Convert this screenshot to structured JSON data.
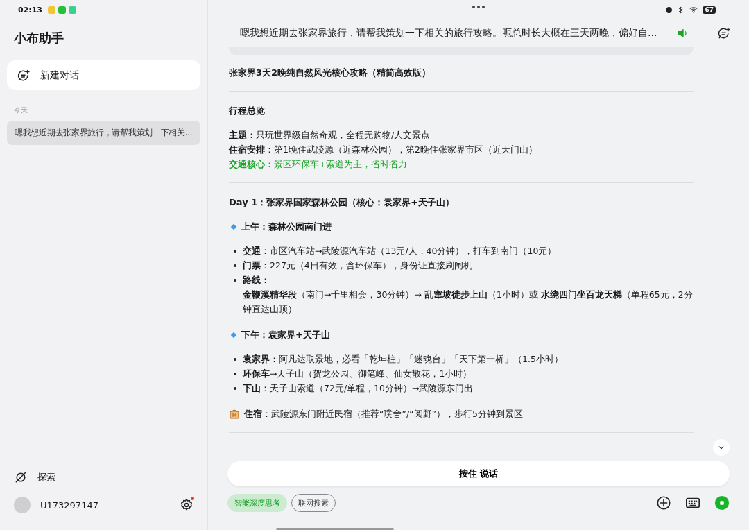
{
  "status_bar": {
    "time": "02:13",
    "battery": "67"
  },
  "sidebar": {
    "title": "小布助手",
    "new_chat": "新建对话",
    "section_label": "今天",
    "history": [
      {
        "text": "嗯我想近期去张家界旅行，请帮我策划一下相关...",
        "selected": true
      }
    ],
    "explore": "探索",
    "user": "U173297147",
    "settings_badge": true
  },
  "header": {
    "query": "嗯我想近期去张家界旅行，请帮我策划一下相关的旅行攻略。呃总时长大概在三天两晚，偏好自..."
  },
  "doc": [
    {
      "kind": "title",
      "text": "张家界3天2晚纯自然风光核心攻略（精简高效版）"
    },
    {
      "kind": "divider"
    },
    {
      "kind": "heading",
      "text": "行程总览"
    },
    {
      "kind": "lines",
      "items": [
        {
          "text": "**主题**：只玩世界级自然奇观，全程无购物/人文景点",
          "highlighted": false
        },
        {
          "text": "**住宿安排**：第1晚住武陵源（近森林公园），第2晚住张家界市区（近天门山）",
          "highlighted": false
        },
        {
          "text": "**交通核心**：景区环保车+索道为主，省时省力",
          "highlighted": true
        }
      ]
    },
    {
      "kind": "divider"
    },
    {
      "kind": "heading",
      "text": "Day 1：张家界国家森林公园（核心：袁家界+天子山）"
    },
    {
      "kind": "section",
      "text": "上午：森林公园南门进"
    },
    {
      "kind": "bullets",
      "items": [
        {
          "text": "**交通**：市区汽车站→武陵源汽车站（13元/人，40分钟），打车到南门（10元）"
        },
        {
          "text": "**门票**：227元（4日有效，含环保车），身份证直接刷闸机"
        },
        {
          "text": "**路线**：",
          "detail": "**金鞭溪精华段**（南门→千里相会，30分钟）→ **乱窜坡徒步上山**（1小时）或 **水绕四门坐百龙天梯**（单程65元，2分钟直达山顶）"
        }
      ]
    },
    {
      "kind": "section",
      "text": "下午：袁家界+天子山"
    },
    {
      "kind": "bullets",
      "items": [
        {
          "text": "**袁家界**：阿凡达取景地，必看「乾坤柱」「迷魂台」「天下第一桥」（1.5小时）"
        },
        {
          "text": "**环保车**→天子山（贺龙公园、御笔峰、仙女散花，1小时）"
        },
        {
          "text": "**下山**：天子山索道（72元/单程，10分钟）→武陵源东门出"
        }
      ]
    },
    {
      "kind": "note",
      "text": "**住宿**：武陵源东门附近民宿（推荐“璞舍”/“阅野”），步行5分钟到景区"
    },
    {
      "kind": "divider"
    }
  ],
  "input": {
    "hold_to_talk": "按住 说话",
    "chips": [
      {
        "label": "智能深度思考",
        "selected": true
      },
      {
        "label": "联网搜索",
        "selected": false
      }
    ]
  }
}
